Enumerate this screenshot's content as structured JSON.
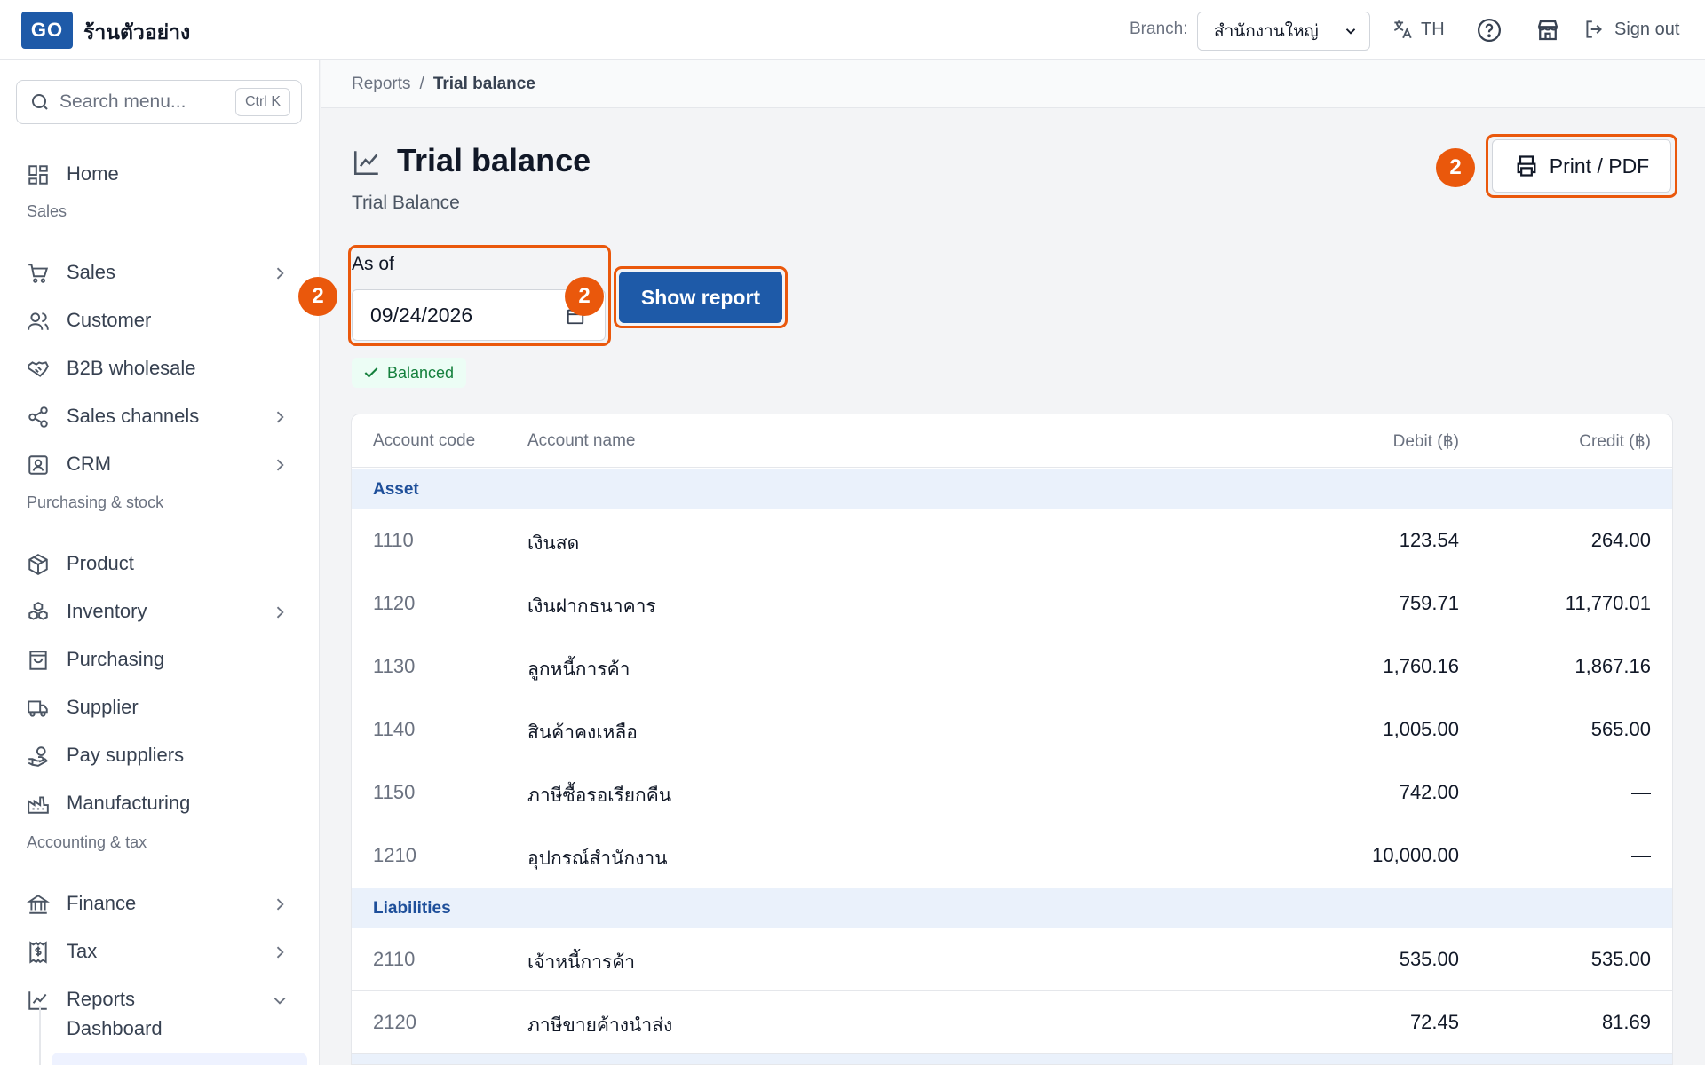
{
  "topbar": {
    "logo": "GO",
    "shop_name": "ร้านตัวอย่าง",
    "branch_label": "Branch:",
    "branch_value": "สำนักงานใหญ่",
    "language": "TH",
    "sign_out": "Sign out"
  },
  "sidebar": {
    "search_placeholder": "Search menu...",
    "search_shortcut": "Ctrl K",
    "home": "Home",
    "sections": {
      "sales": "Sales",
      "purchasing": "Purchasing & stock",
      "accounting": "Accounting & tax"
    },
    "items": {
      "sales": "Sales",
      "customer": "Customer",
      "b2b": "B2B wholesale",
      "channels": "Sales channels",
      "crm": "CRM",
      "product": "Product",
      "inventory": "Inventory",
      "purchasing": "Purchasing",
      "supplier": "Supplier",
      "pay_suppliers": "Pay suppliers",
      "manufacturing": "Manufacturing",
      "finance": "Finance",
      "tax": "Tax",
      "reports": "Reports",
      "dashboard": "Dashboard"
    }
  },
  "breadcrumb": {
    "parent": "Reports",
    "sep": "/",
    "current": "Trial balance"
  },
  "page": {
    "title": "Trial balance",
    "subtitle": "Trial Balance",
    "print_label": "Print / PDF",
    "as_of_label": "As of",
    "date_value": "09/24/2026",
    "show_report_label": "Show report",
    "status": "Balanced",
    "step_badge": "2"
  },
  "table": {
    "headers": {
      "code": "Account code",
      "name": "Account name",
      "debit": "Debit (฿)",
      "credit": "Credit (฿)"
    },
    "groups": [
      {
        "name": "Asset",
        "rows": [
          {
            "code": "1110",
            "name": "เงินสด",
            "debit": "123.54",
            "credit": "264.00"
          },
          {
            "code": "1120",
            "name": "เงินฝากธนาคาร",
            "debit": "759.71",
            "credit": "11,770.01"
          },
          {
            "code": "1130",
            "name": "ลูกหนี้การค้า",
            "debit": "1,760.16",
            "credit": "1,867.16"
          },
          {
            "code": "1140",
            "name": "สินค้าคงเหลือ",
            "debit": "1,005.00",
            "credit": "565.00"
          },
          {
            "code": "1150",
            "name": "ภาษีซื้อรอเรียกคืน",
            "debit": "742.00",
            "credit": "—"
          },
          {
            "code": "1210",
            "name": "อุปกรณ์สำนักงาน",
            "debit": "10,000.00",
            "credit": "—"
          }
        ]
      },
      {
        "name": "Liabilities",
        "rows": [
          {
            "code": "2110",
            "name": "เจ้าหนี้การค้า",
            "debit": "535.00",
            "credit": "535.00"
          },
          {
            "code": "2120",
            "name": "ภาษีขายค้างนำส่ง",
            "debit": "72.45",
            "credit": "81.69"
          }
        ]
      }
    ]
  },
  "colors": {
    "brand": "#1e5aa8",
    "highlight": "#ea580c",
    "success": "#15803d",
    "group_bg": "#eaf1fb"
  }
}
